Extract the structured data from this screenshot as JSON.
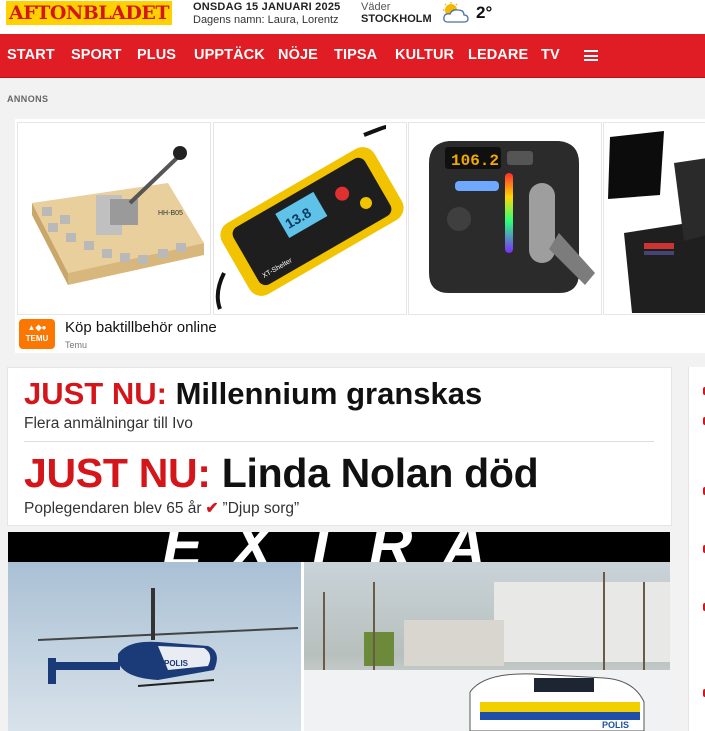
{
  "header": {
    "logo": "AFTONBLADET",
    "date": "ONSDAG 15 JANUARI 2025",
    "names": "Dagens namn: Laura, Lorentz",
    "weather_label": "Väder",
    "weather_city": "STOCKHOLM",
    "weather_icon": "partly-cloudy-icon",
    "temperature": "2°"
  },
  "nav": {
    "items": [
      "START",
      "SPORT",
      "PLUS",
      "UPPTÄCK",
      "NÖJE",
      "TIPSA",
      "KULTUR",
      "LEDARE",
      "TV"
    ],
    "menu_icon": "hamburger-menu-icon"
  },
  "ad": {
    "label": "ANNONS",
    "title": "Köp baktillbehör online",
    "brand": "Temu",
    "brand_logo": "TEMU",
    "products": [
      "bench-tool-product",
      "battery-charger-product",
      "car-fm-transmitter-product",
      "wallet-product"
    ],
    "charger_display": "13.8",
    "charger_label": "XT-Shelter",
    "transmitter_display": "106.2",
    "tool_label": "HH-B05"
  },
  "news": {
    "items": [
      {
        "tag": "JUST NU:",
        "headline": "Millennium granskas",
        "subtitle": "Flera anmälningar till Ivo"
      },
      {
        "tag": "JUST NU:",
        "headline": "Linda Nolan död",
        "subtitle": "Poplegendaren blev 65 år",
        "sub_extra": "”Djup sorg”"
      }
    ]
  },
  "extra": {
    "banner": "EXTRA",
    "police_text": "POLIS"
  },
  "colors": {
    "brand_red": "#e01c25",
    "logo_yellow": "#ffd100",
    "temu_orange": "#fb7701"
  }
}
